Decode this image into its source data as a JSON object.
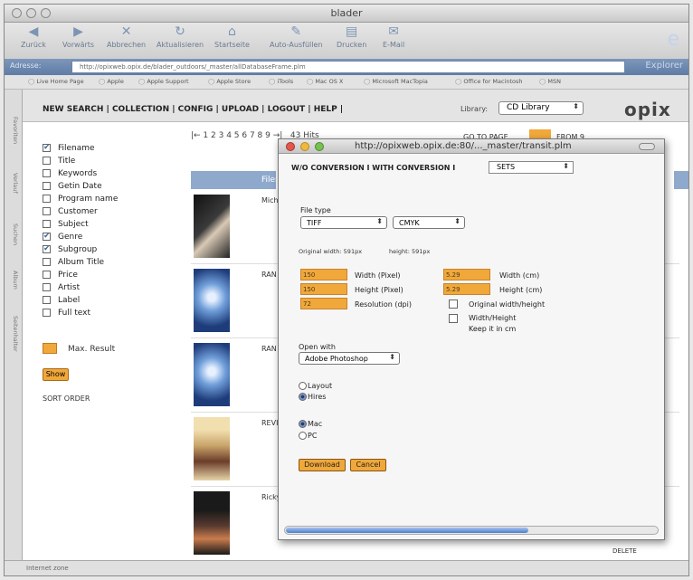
{
  "window": {
    "title": "blader"
  },
  "toolbar": {
    "buttons": [
      "Zurück",
      "Vorwärts",
      "Abbrechen",
      "Aktualisieren",
      "Startseite",
      "Auto-Ausfüllen",
      "Drucken",
      "E-Mail"
    ]
  },
  "address": {
    "label": "Adresse:",
    "url": "http://opixweb.opix.de/blader_outdoors/_master/allDatabaseFrame.plm",
    "explorer": "Explorer"
  },
  "favorites": [
    "Live Home Page",
    "Apple",
    "Apple Support",
    "Apple Store",
    "iTools",
    "Mac OS X",
    "Microsoft MacTopia",
    "Office for Macintosh",
    "MSN"
  ],
  "sidetabs": [
    "Favoriten",
    "Verlauf",
    "Suchen",
    "Album",
    "Seitenhalter"
  ],
  "app": {
    "menu": "NEW SEARCH | COLLECTION | CONFIG | UPLOAD | LOGOUT | HELP |",
    "library_label": "Library:",
    "library_value": "CD Library",
    "logo": "opix"
  },
  "fields": [
    {
      "label": "Filename",
      "checked": true
    },
    {
      "label": "Title",
      "checked": false
    },
    {
      "label": "Keywords",
      "checked": false
    },
    {
      "label": "Getin Date",
      "checked": false
    },
    {
      "label": "Program name",
      "checked": false
    },
    {
      "label": "Customer",
      "checked": false
    },
    {
      "label": "Subject",
      "checked": false
    },
    {
      "label": "Genre",
      "checked": true
    },
    {
      "label": "Subgroup",
      "checked": true
    },
    {
      "label": "Album Title",
      "checked": false
    },
    {
      "label": "Price",
      "checked": false
    },
    {
      "label": "Artist",
      "checked": false
    },
    {
      "label": "Label",
      "checked": false
    },
    {
      "label": "Full text",
      "checked": false
    }
  ],
  "max_result_label": "Max. Result",
  "show_label": "Show",
  "sort_order_label": "SORT ORDER",
  "pager": {
    "text": "|← 1 2 3 4 5 6 7 8 9 →|",
    "hits": "43 Hits",
    "goto": "GO TO PAGE",
    "from": "FROM 9"
  },
  "results_header": "Filer",
  "results": [
    "Mich",
    "RAN",
    "RAN",
    "REVI",
    "Ricky"
  ],
  "delete_label": "DELETE",
  "popup": {
    "title": "http://opixweb.opix.de:80/..._master/transit.plm",
    "nav": "W/O CONVERSION  I  WITH CONVERSION  I",
    "nav_select": "SETS",
    "file_type_label": "File type",
    "file_type": "TIFF",
    "color_mode": "CMYK",
    "orig_width": "Original width: 591px",
    "orig_height": "height: 591px",
    "width_px": "150",
    "height_px": "150",
    "resolution": "72",
    "width_px_label": "Width (Pixel)",
    "height_px_label": "Height (Pixel)",
    "resolution_label": "Resolution (dpi)",
    "width_cm": "5.29",
    "height_cm": "5.29",
    "width_cm_label": "Width (cm)",
    "height_cm_label": "Height (cm)",
    "orig_wh_label": "Original width/height",
    "wh_keep_label": "Width/Height",
    "keep_cm_label": "Keep it in cm",
    "open_with_label": "Open with",
    "open_with": "Adobe Photoshop",
    "layout_label": "Layout",
    "hires_label": "Hires",
    "mac_label": "Mac",
    "pc_label": "PC",
    "download_label": "Download",
    "cancel_label": "Cancel"
  },
  "status": "Internet zone"
}
